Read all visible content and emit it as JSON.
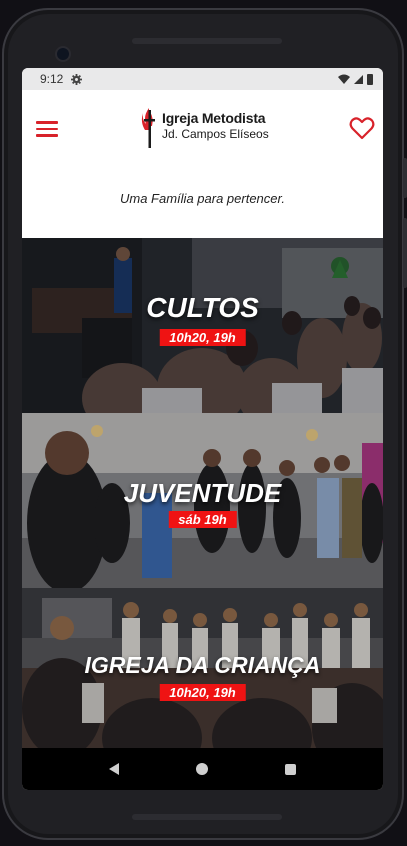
{
  "statusbar": {
    "time": "9:12"
  },
  "header": {
    "logo_name": "Igreja Metodista",
    "logo_sub": "Jd. Campos Elíseos"
  },
  "tagline": "Uma Família para pertencer.",
  "cards": [
    {
      "title": "CULTOS",
      "schedule": "10h20, 19h"
    },
    {
      "title": "JUVENTUDE",
      "schedule": "sáb 19h"
    },
    {
      "title": "IGREJA DA CRIANÇA",
      "schedule": "10h20, 19h"
    }
  ],
  "colors": {
    "brand_red": "#d8222a",
    "badge_red": "#ef1313",
    "statusbar": "#e9e9ea"
  },
  "icons": [
    "gear-icon",
    "wifi-icon",
    "signal-icon",
    "battery-icon",
    "menu-icon",
    "heart-icon",
    "cross-flame-logo-icon",
    "nav-back-icon",
    "nav-home-icon",
    "nav-recent-icon"
  ]
}
